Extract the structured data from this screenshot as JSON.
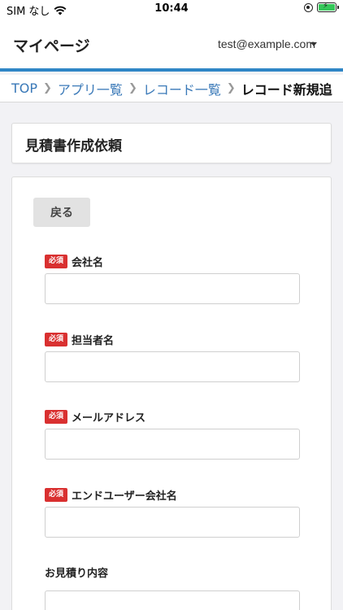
{
  "status_bar": {
    "carrier": "SIM なし",
    "time": "10:44"
  },
  "header": {
    "title": "マイページ",
    "user_email": "test@example.com"
  },
  "breadcrumb": {
    "items": [
      "TOP",
      "アプリ一覧",
      "レコード一覧"
    ],
    "current": "レコード新規追"
  },
  "form": {
    "title": "見積書作成依頼",
    "back_label": "戻る",
    "required_label": "必須",
    "fields": [
      {
        "label": "会社名",
        "value": "",
        "required": true
      },
      {
        "label": "担当者名",
        "value": "",
        "required": true
      },
      {
        "label": "メールアドレス",
        "value": "",
        "required": true
      },
      {
        "label": "エンドユーザー会社名",
        "value": "",
        "required": true
      },
      {
        "label": "お見積り内容",
        "value": "",
        "required": false
      }
    ]
  },
  "colors": {
    "accent": "#2f86c6",
    "link": "#3a79b8",
    "required": "#d93030",
    "background": "#f2f2f5"
  }
}
